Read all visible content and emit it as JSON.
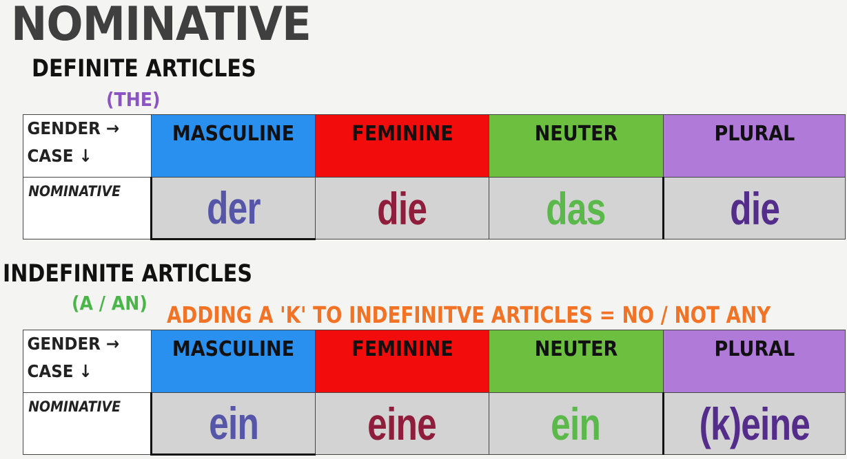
{
  "title": "NOMINATIVE",
  "definite": {
    "heading": "DEFINITE ARTICLES",
    "subheading": "(THE)",
    "gender_label": "GENDER →",
    "case_label": "CASE ↓",
    "row_label": "NOMINATIVE",
    "columns": [
      {
        "label": "MASCULINE",
        "bg": "#2a90f0",
        "value": "der",
        "value_color": "#5656a8"
      },
      {
        "label": "FEMININE",
        "bg": "#f20c0c",
        "value": "die",
        "value_color": "#8e1e3c"
      },
      {
        "label": "NEUTER",
        "bg": "#6dbf3f",
        "value": "das",
        "value_color": "#5ab94a"
      },
      {
        "label": "PLURAL",
        "bg": "#b07ad8",
        "value": "die",
        "value_color": "#542d8a"
      }
    ]
  },
  "indefinite": {
    "heading": "INDEFINITE ARTICLES",
    "subheading": "(A / AN)",
    "note": "ADDING A 'K' TO INDEFINITVE ARTICLES = NO / NOT ANY",
    "gender_label": "GENDER →",
    "case_label": "CASE ↓",
    "row_label": "NOMINATIVE",
    "columns": [
      {
        "label": "MASCULINE",
        "bg": "#2a90f0",
        "value": "ein",
        "value_color": "#5656a8"
      },
      {
        "label": "FEMININE",
        "bg": "#f20c0c",
        "value": "eine",
        "value_color": "#8e1e3c"
      },
      {
        "label": "NEUTER",
        "bg": "#6dbf3f",
        "value": "ein",
        "value_color": "#5ab94a"
      },
      {
        "label": "PLURAL",
        "bg": "#b07ad8",
        "value": "(k)eine",
        "value_color": "#542d8a"
      }
    ]
  }
}
